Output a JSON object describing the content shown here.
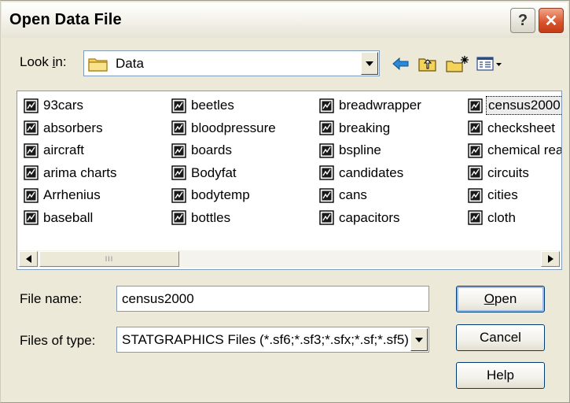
{
  "dialog": {
    "title": "Open Data File",
    "help_glyph": "?",
    "close_glyph": "✕"
  },
  "lookin": {
    "label_prefix": "Look ",
    "label_underlined": "i",
    "label_suffix": "n:",
    "value": "Data"
  },
  "files": {
    "columns": [
      [
        "93cars",
        "absorbers",
        "aircraft",
        "arima charts",
        "Arrhenius",
        "baseball"
      ],
      [
        "beetles",
        "bloodpressure",
        "boards",
        "Bodyfat",
        "bodytemp",
        "bottles"
      ],
      [
        "breadwrapper",
        "breaking",
        "bspline",
        "candidates",
        "cans",
        "capacitors"
      ],
      [
        "census2000",
        "checksheet",
        "chemical rea",
        "circuits",
        "cities",
        "cloth"
      ]
    ],
    "selected": "census2000",
    "scroll_grip": "III"
  },
  "filename": {
    "label": "File name:",
    "value": "census2000"
  },
  "filetype": {
    "label": "Files of type:",
    "value": "STATGRAPHICS Files (*.sf6;*.sf3;*.sfx;*.sf;*.sf5)"
  },
  "buttons": {
    "open_underlined": "O",
    "open_rest": "pen",
    "cancel": "Cancel",
    "help": "Help"
  },
  "colors": {
    "dialog_bg": "#ece9d8",
    "close_red": "#d8512a",
    "back_arrow": "#2a8ad8",
    "folder_yellow": "#f4d35a"
  },
  "icons": {
    "folder": "folder-icon",
    "back": "back-arrow-icon",
    "up": "up-folder-icon",
    "new_folder": "new-folder-icon",
    "view_menu": "view-menu-icon",
    "file": "statgraphics-file-icon"
  }
}
